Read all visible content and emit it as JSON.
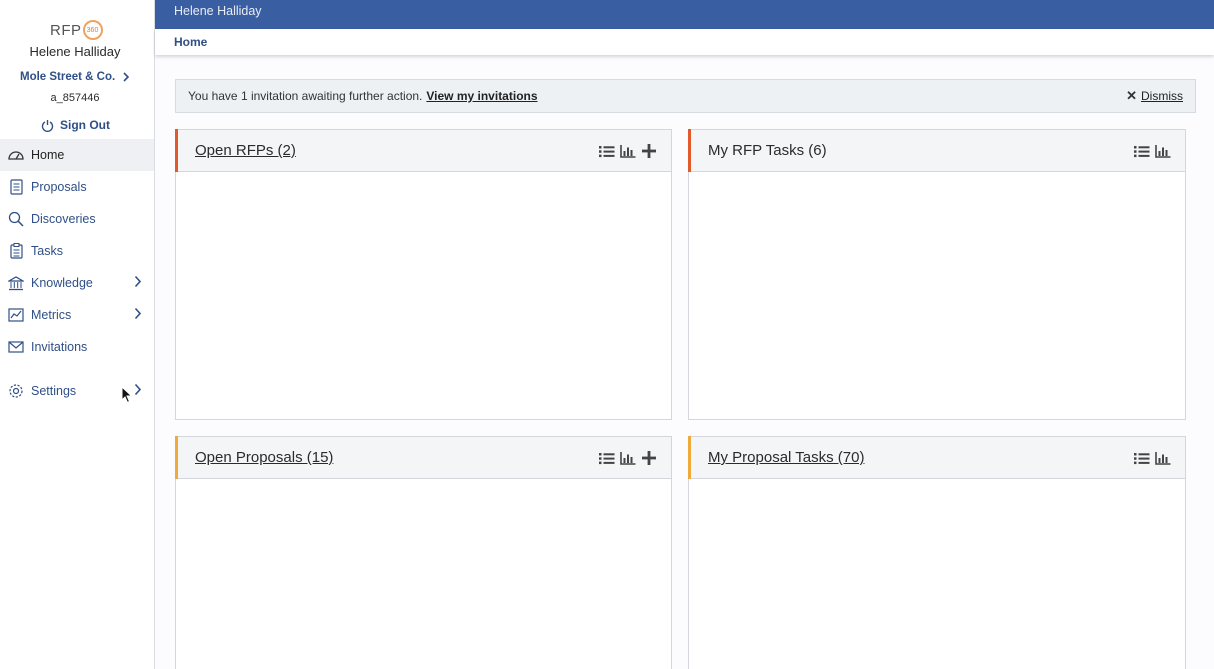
{
  "app": {
    "logo_text": "RFP",
    "logo_badge": "360"
  },
  "user": {
    "name": "Helene Halliday",
    "company": "Mole Street & Co.",
    "account_id": "a_857446",
    "signout_label": "Sign Out"
  },
  "nav": {
    "items": [
      {
        "label": "Home",
        "icon": "dashboard-icon",
        "active": true
      },
      {
        "label": "Proposals",
        "icon": "document-icon"
      },
      {
        "label": "Discoveries",
        "icon": "search-icon"
      },
      {
        "label": "Tasks",
        "icon": "clipboard-icon"
      },
      {
        "label": "Knowledge",
        "icon": "bank-icon",
        "has_submenu": true
      },
      {
        "label": "Metrics",
        "icon": "line-chart-icon",
        "has_submenu": true
      },
      {
        "label": "Invitations",
        "icon": "envelope-icon"
      },
      {
        "label": "Settings",
        "icon": "gear-icon",
        "has_submenu": true
      }
    ]
  },
  "header": {
    "user_name": "Helene Halliday",
    "breadcrumb": "Home"
  },
  "alert": {
    "message": "You have 1 invitation awaiting further action.",
    "link_label": "View my invitations",
    "dismiss_label": "Dismiss"
  },
  "panels": [
    {
      "title": "Open RFPs (2)",
      "accent": "#e05a2b",
      "linked": true,
      "tools": [
        "list-icon",
        "bar-chart-icon",
        "plus-icon"
      ]
    },
    {
      "title": "My RFP Tasks (6)",
      "accent": "#e05a2b",
      "linked": false,
      "tools": [
        "list-icon",
        "bar-chart-icon"
      ]
    },
    {
      "title": "Open Proposals (15)",
      "accent": "#f0a93b",
      "linked": true,
      "tools": [
        "list-icon",
        "bar-chart-icon",
        "plus-icon"
      ]
    },
    {
      "title": "My Proposal Tasks (70)",
      "accent": "#f0a93b",
      "linked": true,
      "tools": [
        "list-icon",
        "bar-chart-icon"
      ]
    }
  ],
  "colors": {
    "topbar": "#3a5ea2",
    "link": "#2f4f86",
    "rfp_accent": "#e05a2b",
    "proposal_accent": "#f0a93b"
  }
}
